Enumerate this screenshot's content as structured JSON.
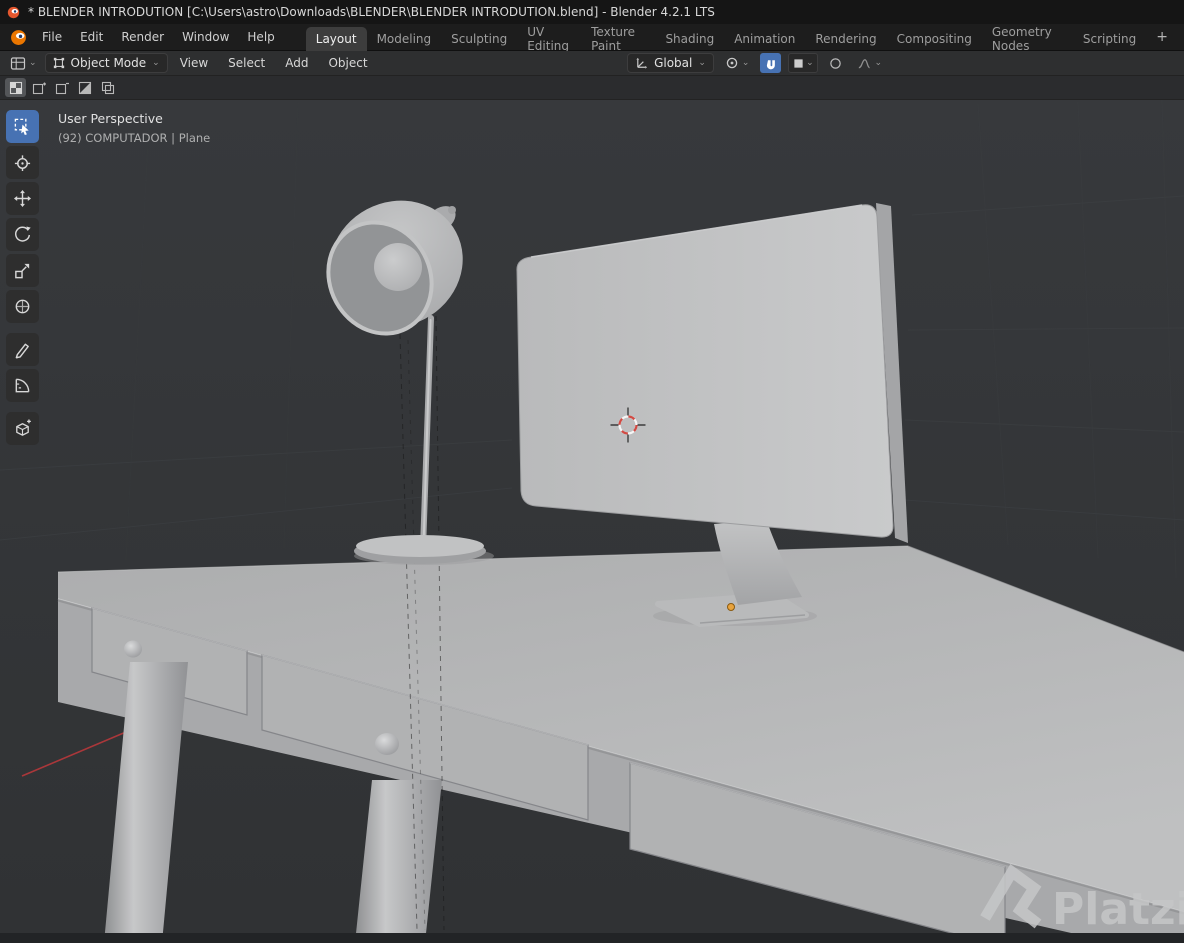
{
  "titlebar": {
    "title": "* BLENDER INTRODUTION [C:\\Users\\astro\\Downloads\\BLENDER\\BLENDER INTRODUTION.blend] - Blender 4.2.1 LTS"
  },
  "menubar": {
    "menus": [
      "File",
      "Edit",
      "Render",
      "Window",
      "Help"
    ],
    "tabs": [
      {
        "label": "Layout",
        "active": true
      },
      {
        "label": "Modeling"
      },
      {
        "label": "Sculpting"
      },
      {
        "label": "UV Editing"
      },
      {
        "label": "Texture Paint"
      },
      {
        "label": "Shading"
      },
      {
        "label": "Animation"
      },
      {
        "label": "Rendering"
      },
      {
        "label": "Compositing"
      },
      {
        "label": "Geometry Nodes"
      },
      {
        "label": "Scripting"
      }
    ],
    "add_tab": "+"
  },
  "tool_header": {
    "mode": "Object Mode",
    "menus": [
      "View",
      "Select",
      "Add",
      "Object"
    ],
    "orientation": "Global"
  },
  "select_mode_bar": {
    "modes": [
      "set",
      "extend",
      "subtract",
      "invert",
      "intersect"
    ],
    "active": "set"
  },
  "left_toolbar": {
    "tools": [
      "select-box",
      "cursor",
      "move",
      "rotate",
      "scale",
      "transform",
      "annotate",
      "measure",
      "add-cube"
    ],
    "active": "select-box"
  },
  "viewport": {
    "overlay_line1": "User Perspective",
    "overlay_line2": "(92) COMPUTADOR | Plane",
    "watermark": "Platzi"
  },
  "colors": {
    "accent_blue": "#4772b3",
    "blender_orange": "#ea7600",
    "origin_orange": "#e8a33d",
    "axis_red": "#b8383b",
    "header_bg": "#1d1d1d",
    "viewport_bg": "#343639"
  },
  "icons": {
    "chevron_down": "⌄",
    "plus": "+"
  }
}
